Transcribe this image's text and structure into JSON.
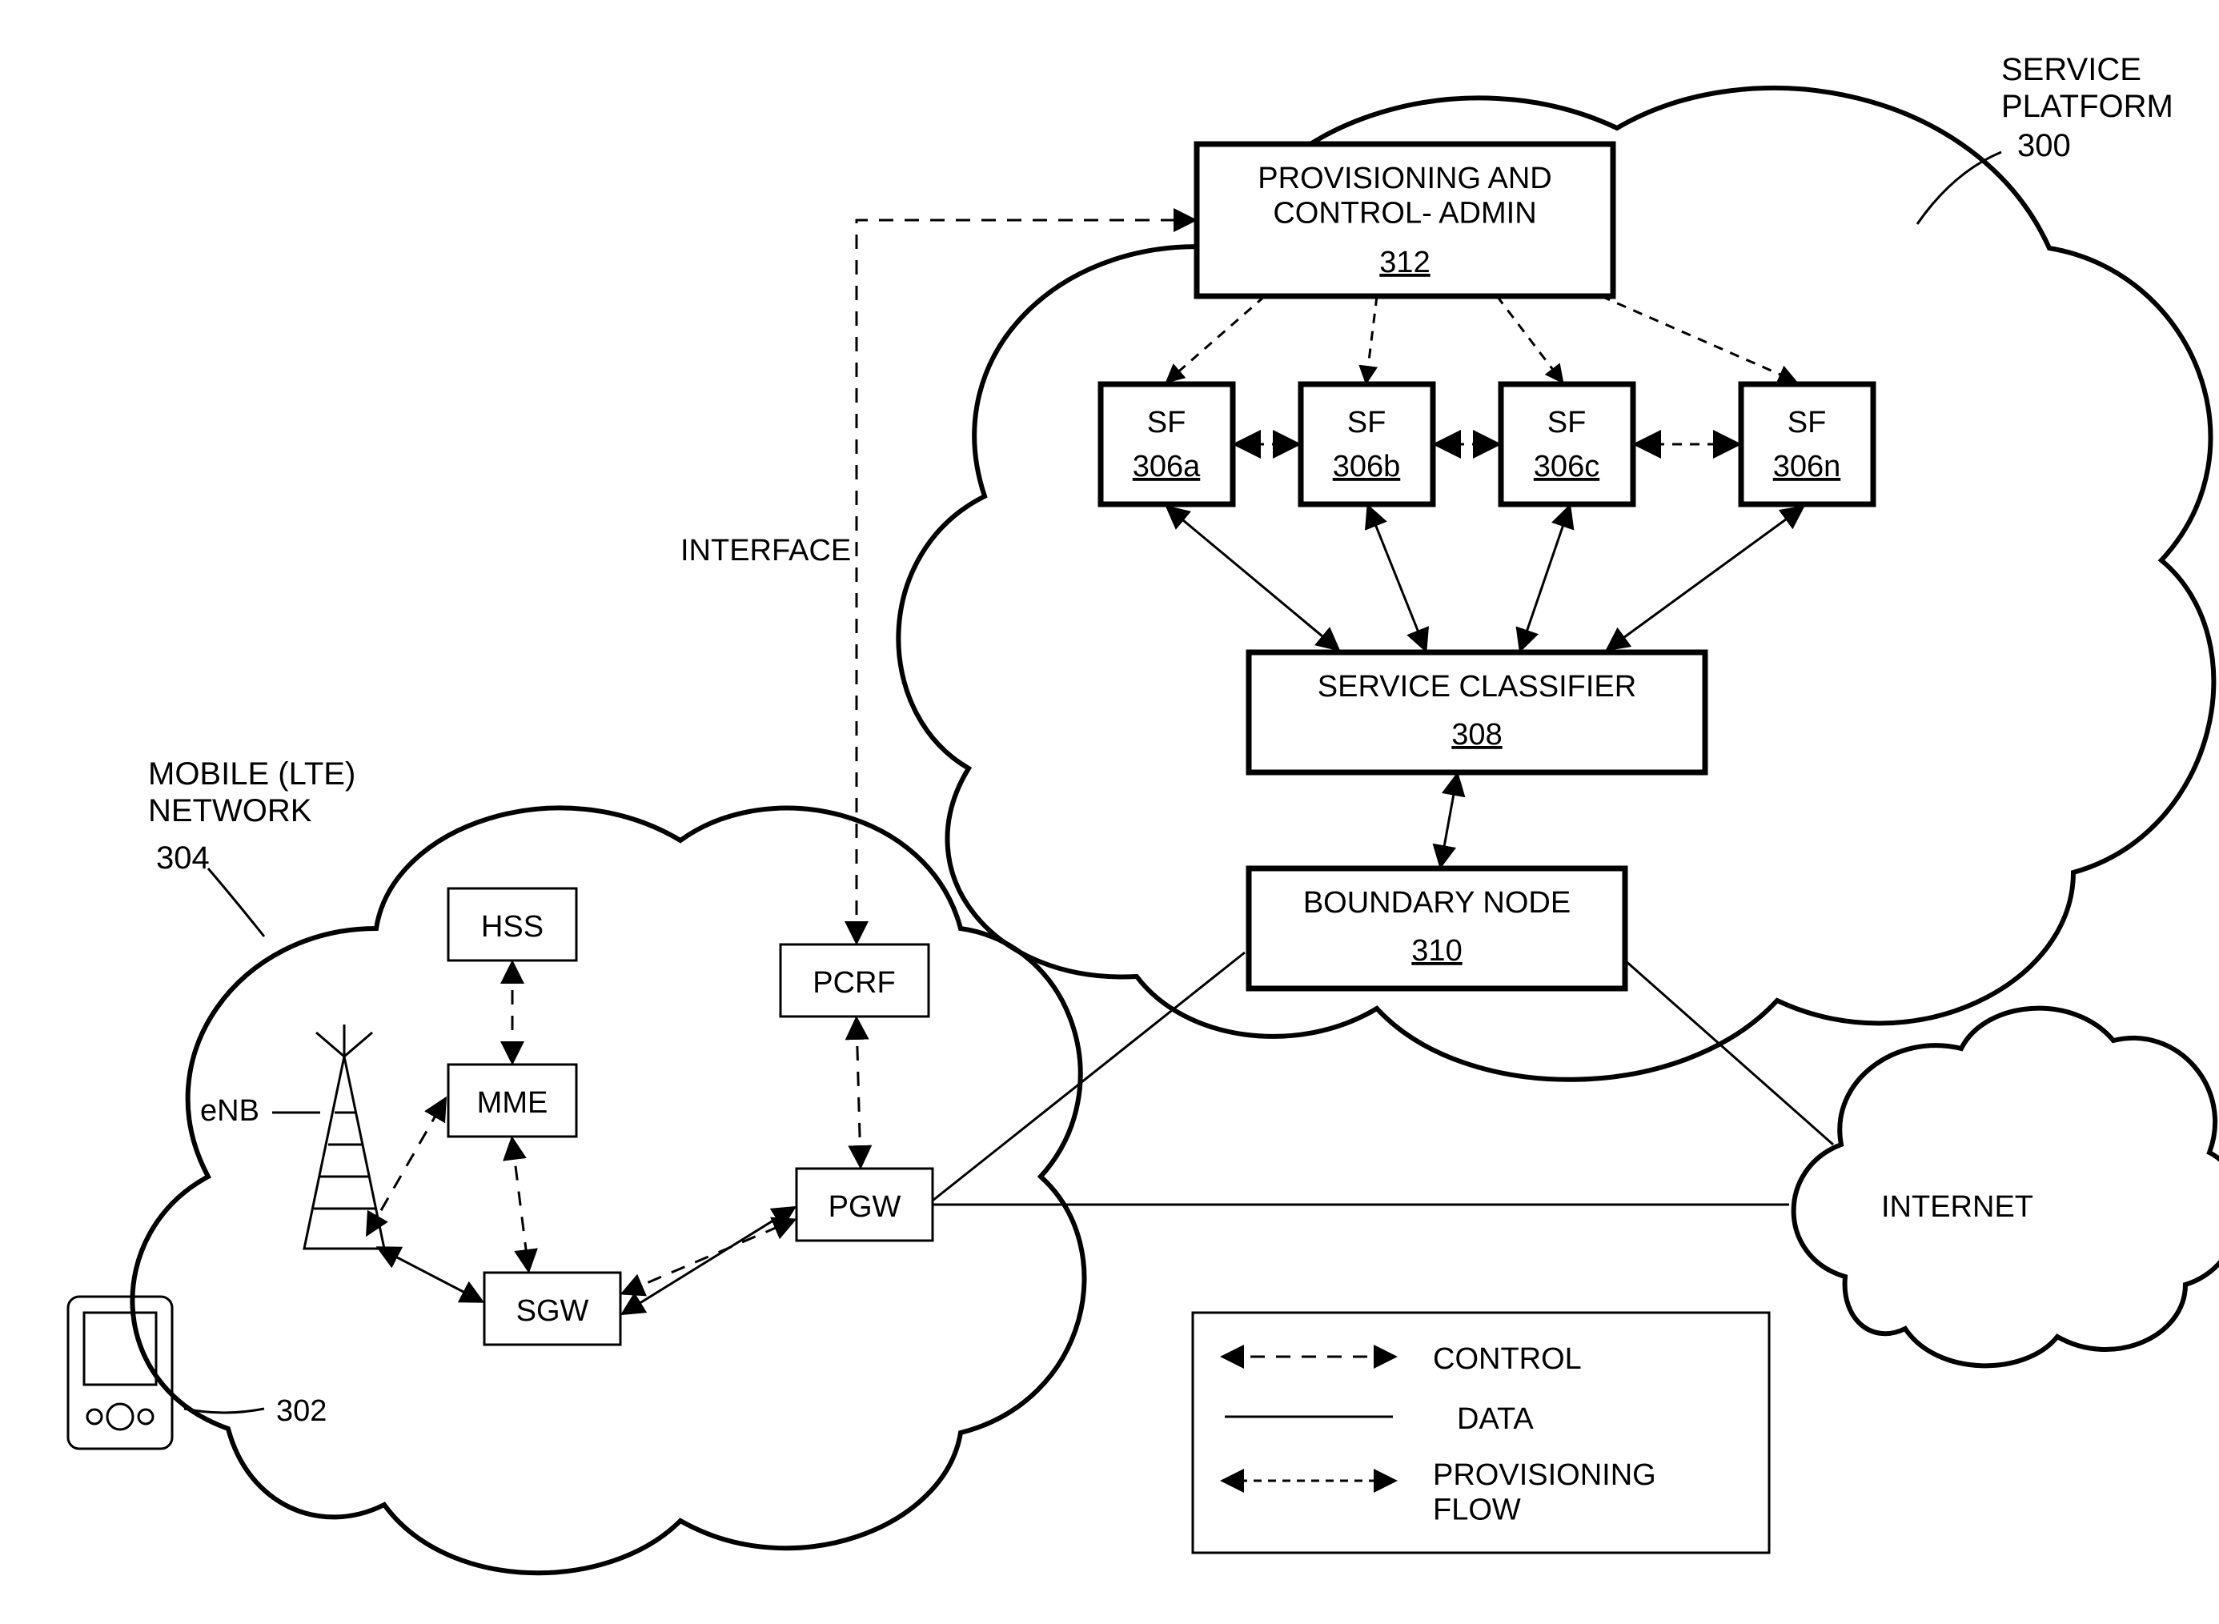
{
  "clouds": {
    "service_platform": {
      "label": "SERVICE\nPLATFORM",
      "ref": "300"
    },
    "mobile_network": {
      "label": "MOBILE (LTE)\nNETWORK",
      "ref": "304"
    },
    "internet": {
      "label": "INTERNET"
    }
  },
  "nodes": {
    "provisioning": {
      "title": "PROVISIONING AND\nCONTROL- ADMIN",
      "ref": "312"
    },
    "sf": [
      {
        "label": "SF",
        "ref": "306a"
      },
      {
        "label": "SF",
        "ref": "306b"
      },
      {
        "label": "SF",
        "ref": "306c"
      },
      {
        "label": "SF",
        "ref": "306n"
      }
    ],
    "service_classifier": {
      "title": "SERVICE CLASSIFIER",
      "ref": "308"
    },
    "boundary_node": {
      "title": "BOUNDARY NODE",
      "ref": "310"
    },
    "hss": {
      "label": "HSS"
    },
    "mme": {
      "label": "MME"
    },
    "pcrf": {
      "label": "PCRF"
    },
    "sgw": {
      "label": "SGW"
    },
    "pgw": {
      "label": "PGW"
    },
    "enb": {
      "label": "eNB"
    }
  },
  "device": {
    "ref": "302"
  },
  "labels": {
    "interface": "INTERFACE"
  },
  "legend": {
    "control": "CONTROL",
    "data": "DATA",
    "provisioning_flow": "PROVISIONING\nFLOW"
  }
}
